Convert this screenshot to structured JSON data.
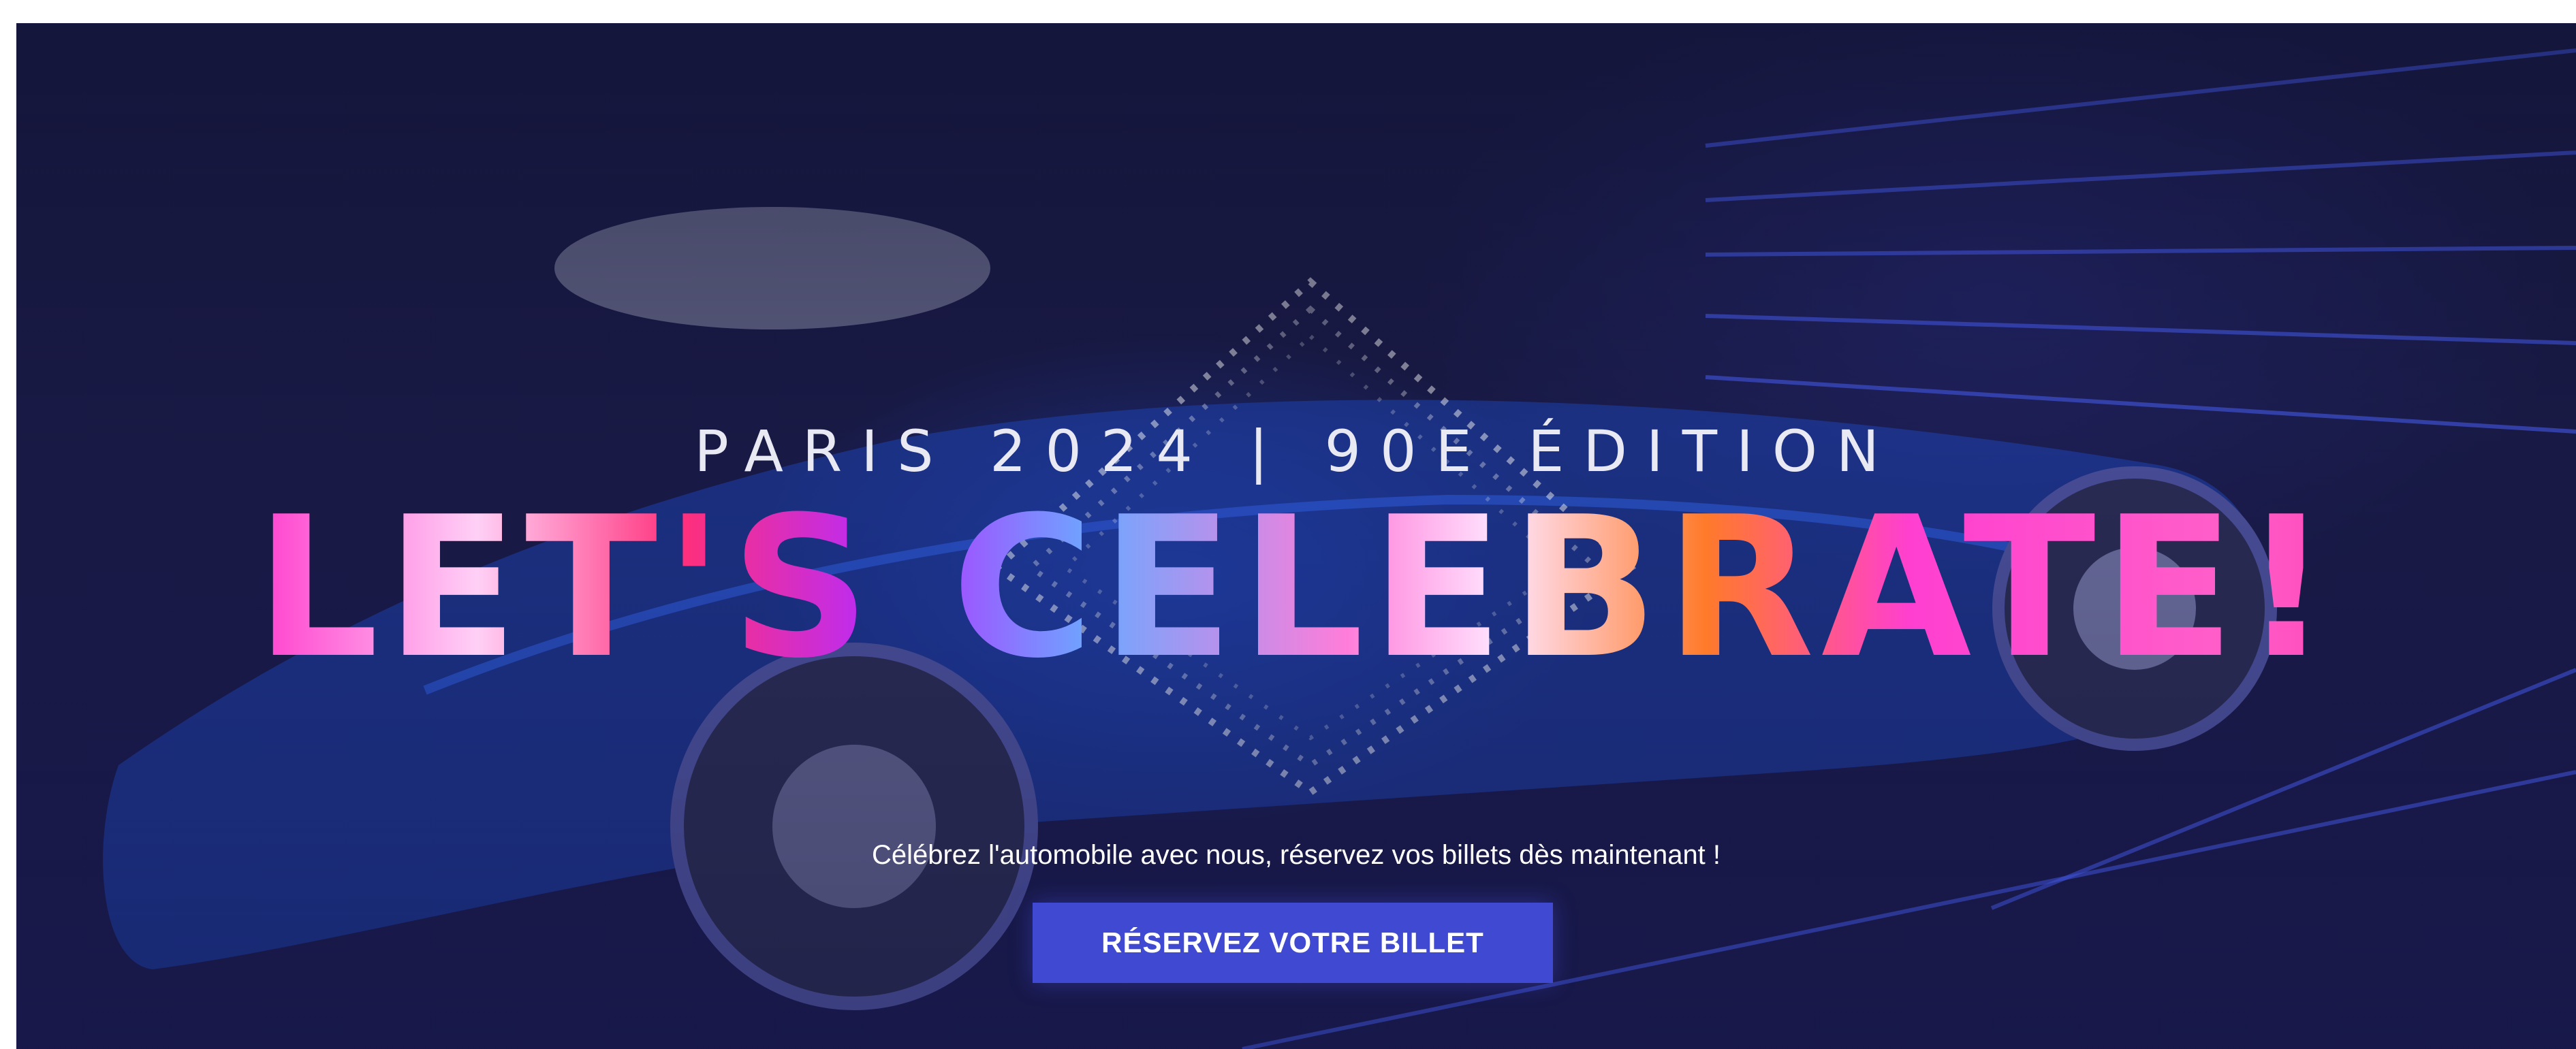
{
  "hero": {
    "eyebrow": "PARIS 2024 | 90E ÉDITION",
    "headline": "LET'S CELEBRATE!",
    "subtitle": "Célébrez l'automobile avec nous, réservez vos billets dès maintenant !",
    "cta_label": "RÉSERVEZ VOTRE BILLET"
  },
  "colors": {
    "background": "#191a46",
    "cta_background": "#3f49d1",
    "headline_accent": "#ff2fb4",
    "text": "#ffffff"
  },
  "icons": {
    "background_image": "concept-car-photo",
    "decoration": "dotted-diamond-pattern"
  }
}
